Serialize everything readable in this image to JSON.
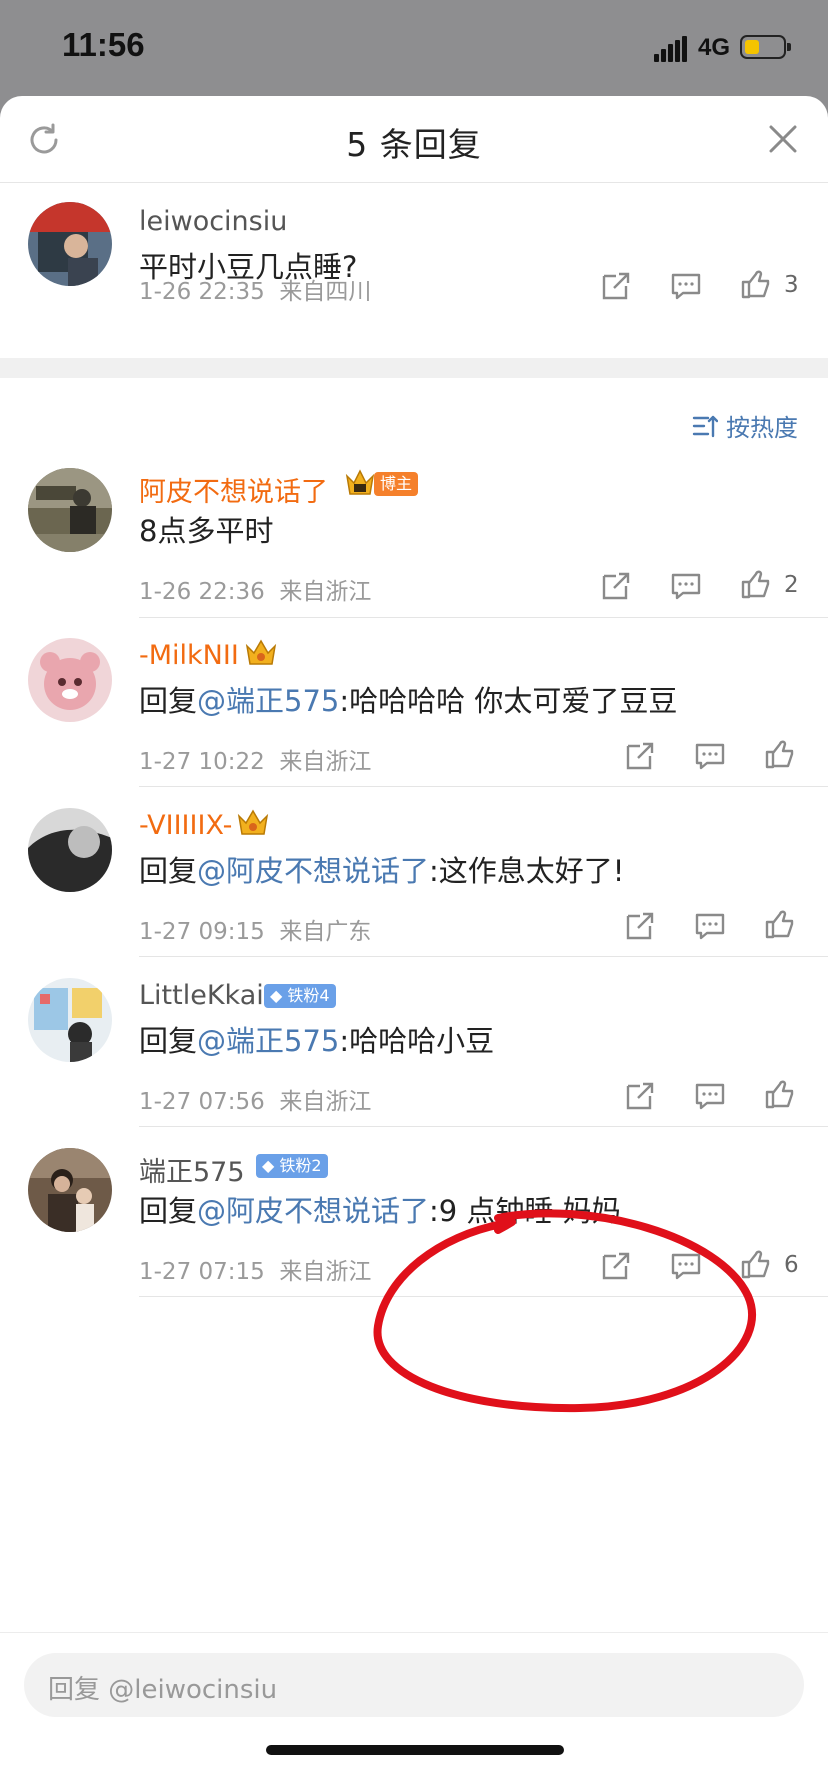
{
  "status_bar": {
    "time": "11:56",
    "network": "4G"
  },
  "header": {
    "title": "5 条回复"
  },
  "main_comment": {
    "username": "leiwocinsiu",
    "text": "平时小豆几点睡?",
    "time": "1-26 22:35",
    "location": "来自四川",
    "likes": "3"
  },
  "sort_label": "按热度",
  "replies": [
    {
      "username": "阿皮不想说话了",
      "badge": "博主",
      "text": "8点多平时",
      "mention": "",
      "time": "1-26 22:36",
      "location": "来自浙江",
      "likes": "2"
    },
    {
      "username": "-MilkNII",
      "prefix": "回复",
      "mention": "@端正575",
      "text": ":哈哈哈哈 你太可爱了豆豆",
      "time": "1-27 10:22",
      "location": "来自浙江",
      "likes": ""
    },
    {
      "username": "-VIIIIIX-",
      "prefix": "回复",
      "mention": "@阿皮不想说话了",
      "text": ":这作息太好了!",
      "time": "1-27 09:15",
      "location": "来自广东",
      "likes": ""
    },
    {
      "username": "LittleKkai",
      "badge": "铁粉4",
      "prefix": "回复",
      "mention": "@端正575",
      "text": ":哈哈哈小豆",
      "time": "1-27 07:56",
      "location": "来自浙江",
      "likes": ""
    },
    {
      "username": "端正575",
      "badge": "铁粉2",
      "prefix": "回复",
      "mention": "@阿皮不想说话了",
      "text": ":9  点钟睡 妈妈",
      "time": "1-27 07:15",
      "location": "来自浙江",
      "likes": "6"
    }
  ],
  "reply_input": {
    "placeholder": "回复 @leiwocinsiu"
  },
  "colors": {
    "accent": "#4a79b1",
    "orange_name": "#f26b11",
    "annotation": "#e0101a"
  }
}
